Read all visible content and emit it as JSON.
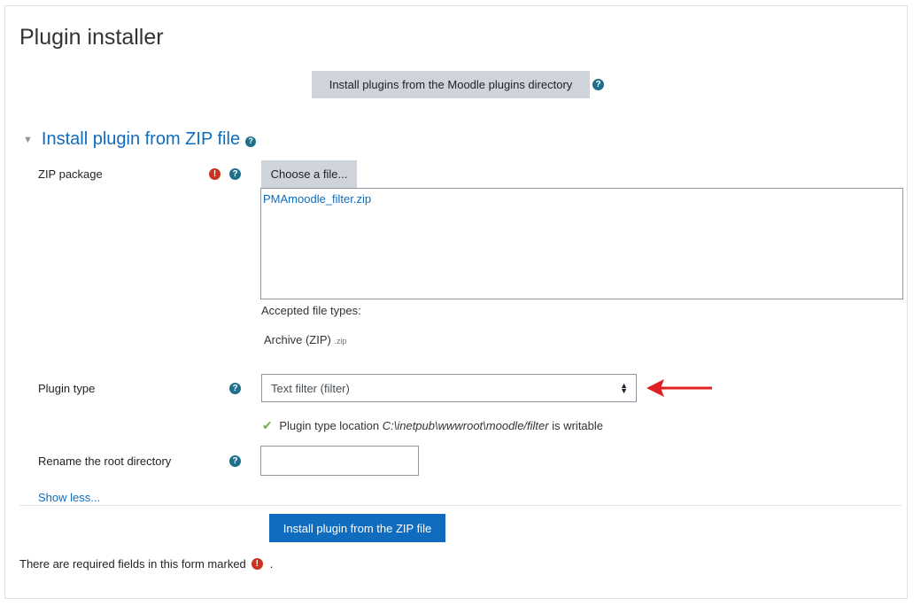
{
  "page": {
    "title": "Plugin installer",
    "directory_button": "Install plugins from the Moodle plugins directory"
  },
  "section": {
    "title": "Install plugin from ZIP file"
  },
  "zip_package": {
    "label": "ZIP package",
    "choose_button": "Choose a file...",
    "selected_file": "PMAmoodle_filter.zip",
    "accepted_label": "Accepted file types:",
    "accepted_type": "Archive (ZIP)",
    "accepted_ext": ".zip"
  },
  "plugin_type": {
    "label": "Plugin type",
    "value": "Text filter (filter)",
    "location_prefix": "Plugin type location",
    "location_path": "C:\\inetpub\\wwwroot\\moodle/filter",
    "location_suffix": "is writable"
  },
  "rename": {
    "label": "Rename the root directory",
    "value": ""
  },
  "show_less": "Show less...",
  "install_button": "Install plugin from the ZIP file",
  "required_note": {
    "text": "There are required fields in this form marked",
    "end": "."
  },
  "icons": {
    "help": "question-circle-icon",
    "required": "exclamation-circle-icon",
    "collapse": "caret-down-icon",
    "check": "check-icon",
    "annotation": "red-arrow-annotation"
  },
  "colors": {
    "link": "#0f6cbf",
    "primary": "#0f6cbf",
    "required": "#ca3120",
    "help": "#1f6f8b",
    "button_gray": "#ced4da",
    "annotation_arrow": "#e02020"
  }
}
